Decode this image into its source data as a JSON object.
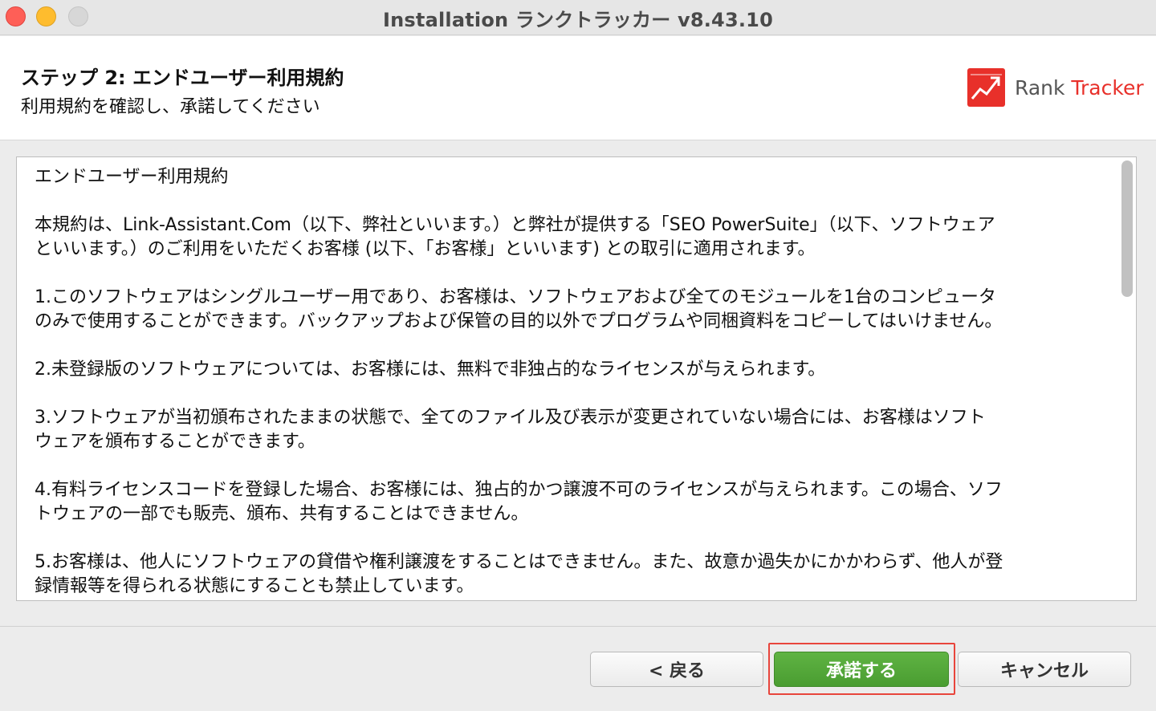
{
  "window": {
    "title": "Installation ランクトラッカー v8.43.10"
  },
  "header": {
    "step_title": "ステップ 2: エンドユーザー利用規約",
    "step_subtitle": "利用規約を確認し、承諾してください",
    "brand_rank": "Rank",
    "brand_tracker": "Tracker"
  },
  "license": {
    "paragraphs": [
      "エンドユーザー利用規約",
      "本規約は、Link-Assistant.Com（以下、弊社といいます。）と弊社が提供する「SEO PowerSuite」（以下、ソフトウェア\nといいます。）のご利用をいただくお客様 (以下、「お客様」といいます) との取引に適用されます。",
      "1.このソフトウェアはシングルユーザー用であり、お客様は、ソフトウェアおよび全てのモジュールを1台のコンピュータ\nのみで使用することができます。バックアップおよび保管の目的以外でプログラムや同梱資料をコピーしてはいけません。",
      "2.未登録版のソフトウェアについては、お客様には、無料で非独占的なライセンスが与えられます。",
      "3.ソフトウェアが当初頒布されたままの状態で、全てのファイル及び表示が変更されていない場合には、お客様はソフト\nウェアを頒布することができます。",
      "4.有料ライセンスコードを登録した場合、お客様には、独占的かつ譲渡不可のライセンスが与えられます。この場合、ソフ\nトウェアの一部でも販売、頒布、共有することはできません。",
      "5.お客様は、他人にソフトウェアの貸借や権利譲渡をすることはできません。また、故意か過失かにかかわらず、他人が登\n録情報等を得られる状態にすることも禁止しています。"
    ]
  },
  "buttons": {
    "back_label": "< 戻る",
    "accept_label": "承諾する",
    "cancel_label": "キャンセル"
  },
  "colors": {
    "accept_green": "#4fa636",
    "brand_red": "#e8302a",
    "highlight_red": "#e8453c"
  },
  "icons": {
    "close": "close-icon",
    "minimize": "minimize-icon",
    "zoom": "zoom-icon",
    "brand_logo": "rank-tracker-logo-icon"
  }
}
